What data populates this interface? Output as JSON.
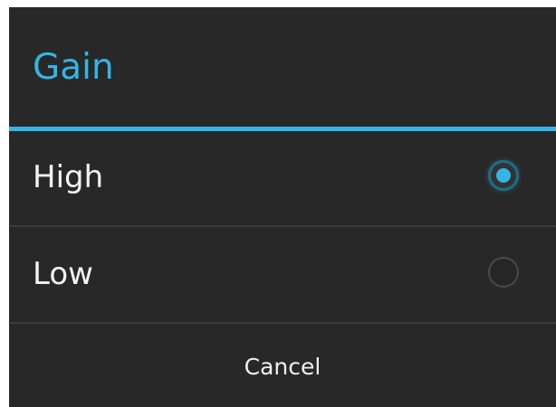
{
  "dialog": {
    "title": "Gain",
    "options": [
      {
        "label": "High",
        "selected": true
      },
      {
        "label": "Low",
        "selected": false
      }
    ],
    "cancel_label": "Cancel"
  },
  "colors": {
    "accent": "#33b5e5",
    "background": "#282828",
    "text": "#f2f2f2",
    "divider": "#3a3a3a"
  },
  "icons": {
    "selected_radio": "radio-checked-icon",
    "unselected_radio": "radio-unchecked-icon"
  }
}
